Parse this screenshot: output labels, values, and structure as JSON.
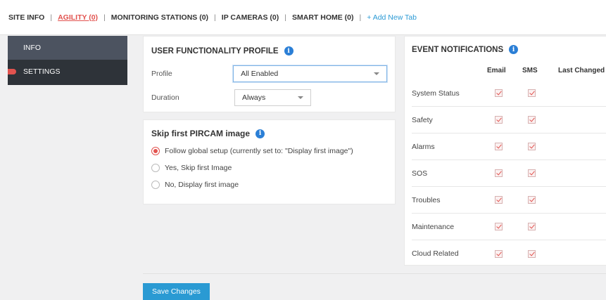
{
  "tabs": [
    {
      "label": "SITE INFO",
      "active": false
    },
    {
      "label": "AGILITY (0)",
      "active": true
    },
    {
      "label": "MONITORING STATIONS (0)",
      "active": false
    },
    {
      "label": "IP CAMERAS (0)",
      "active": false
    },
    {
      "label": "SMART HOME (0)",
      "active": false
    }
  ],
  "add_tab_label": "+ Add New Tab",
  "sidebar": {
    "items": [
      {
        "label": "INFO"
      },
      {
        "label": "SETTINGS"
      }
    ]
  },
  "ufp": {
    "title": "USER FUNCTIONALITY PROFILE",
    "profile_label": "Profile",
    "profile_value": "All Enabled",
    "duration_label": "Duration",
    "duration_value": "Always"
  },
  "pircam": {
    "title": "Skip first PIRCAM image",
    "options": [
      {
        "label": "Follow global setup (currently set to: \"Display first image\")",
        "checked": true
      },
      {
        "label": "Yes, Skip first Image",
        "checked": false
      },
      {
        "label": "No, Display first image",
        "checked": false
      }
    ]
  },
  "events": {
    "title": "EVENT NOTIFICATIONS",
    "columns": {
      "email": "Email",
      "sms": "SMS",
      "last_changed": "Last Changed"
    },
    "rows": [
      {
        "name": "System Status",
        "email": true,
        "sms": true
      },
      {
        "name": "Safety",
        "email": true,
        "sms": true
      },
      {
        "name": "Alarms",
        "email": true,
        "sms": true
      },
      {
        "name": "SOS",
        "email": true,
        "sms": true
      },
      {
        "name": "Troubles",
        "email": true,
        "sms": true
      },
      {
        "name": "Maintenance",
        "email": true,
        "sms": true
      },
      {
        "name": "Cloud Related",
        "email": true,
        "sms": true
      }
    ]
  },
  "save_label": "Save Changes",
  "colors": {
    "accent": "#e2534f",
    "primary": "#2a9ad3",
    "sidebar": "#2e3339"
  }
}
